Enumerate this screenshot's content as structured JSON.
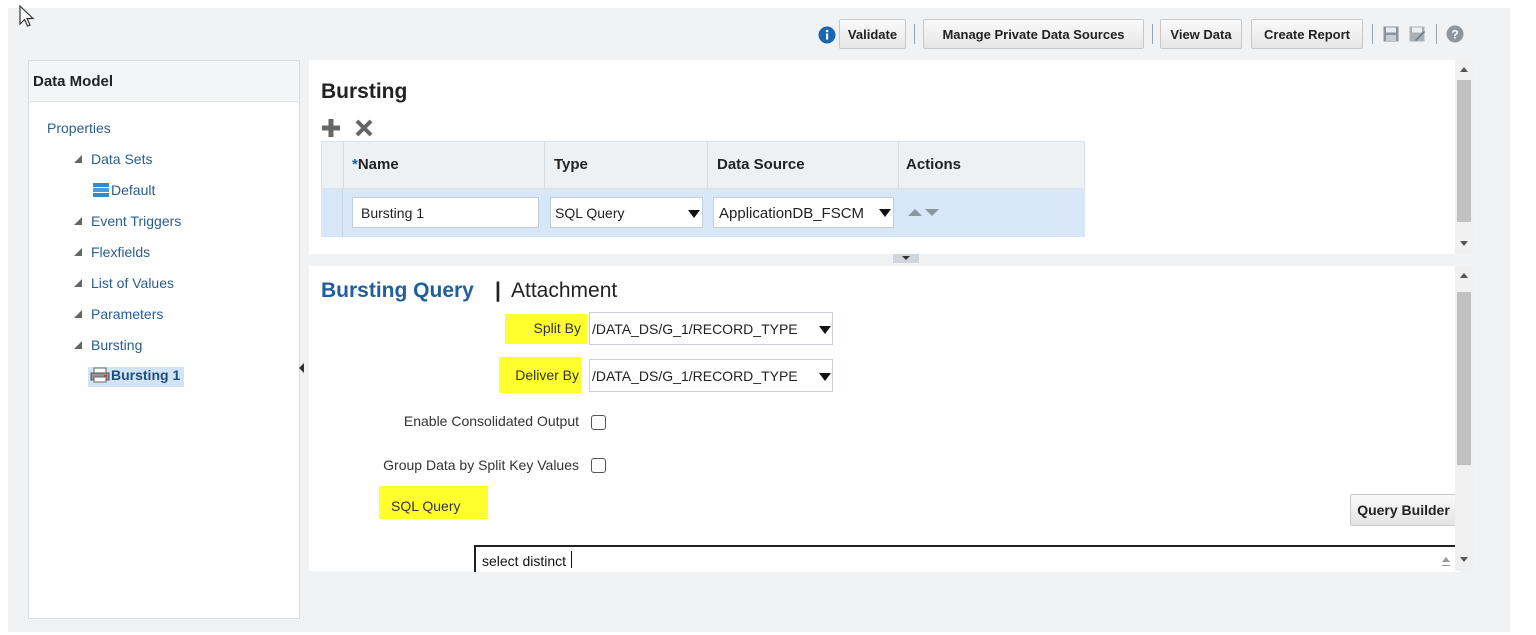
{
  "toolbar": {
    "info_icon": "info-circle-icon",
    "validate_label": "Validate",
    "manage_sources_label": "Manage Private Data Sources",
    "view_data_label": "View Data",
    "create_report_label": "Create Report",
    "icons": [
      "save-icon",
      "save-as-icon",
      "help-icon"
    ]
  },
  "sidebar": {
    "title": "Data Model",
    "items": [
      {
        "label": "Properties"
      },
      {
        "label": "Data Sets"
      },
      {
        "label": "Default"
      },
      {
        "label": "Event Triggers"
      },
      {
        "label": "Flexfields"
      },
      {
        "label": "List of Values"
      },
      {
        "label": "Parameters"
      },
      {
        "label": "Bursting"
      },
      {
        "label": "Bursting 1"
      }
    ]
  },
  "bursting": {
    "title": "Bursting",
    "columns": {
      "required_mark": "*",
      "name": "Name",
      "type": "Type",
      "data_source": "Data Source",
      "actions": "Actions"
    },
    "row": {
      "name": "Bursting 1",
      "type": "SQL Query",
      "data_source": "ApplicationDB_FSCM"
    }
  },
  "detail": {
    "tab_active": "Bursting Query",
    "tab_separator": "|",
    "tab_inactive": "Attachment",
    "split_by_label": "Split By",
    "split_by_value": "/DATA_DS/G_1/RECORD_TYPE",
    "deliver_by_label": "Deliver By",
    "deliver_by_value": "/DATA_DS/G_1/RECORD_TYPE",
    "consolidated_label": "Enable Consolidated Output",
    "group_label": "Group Data by Split Key Values",
    "sql_query_label": "SQL Query",
    "query_builder_label": "Query Builder",
    "sql_text": "select distinct"
  },
  "colors": {
    "highlight": "#ffff2e",
    "link": "#2a5d8f",
    "selected_row": "#d7e7f7"
  }
}
